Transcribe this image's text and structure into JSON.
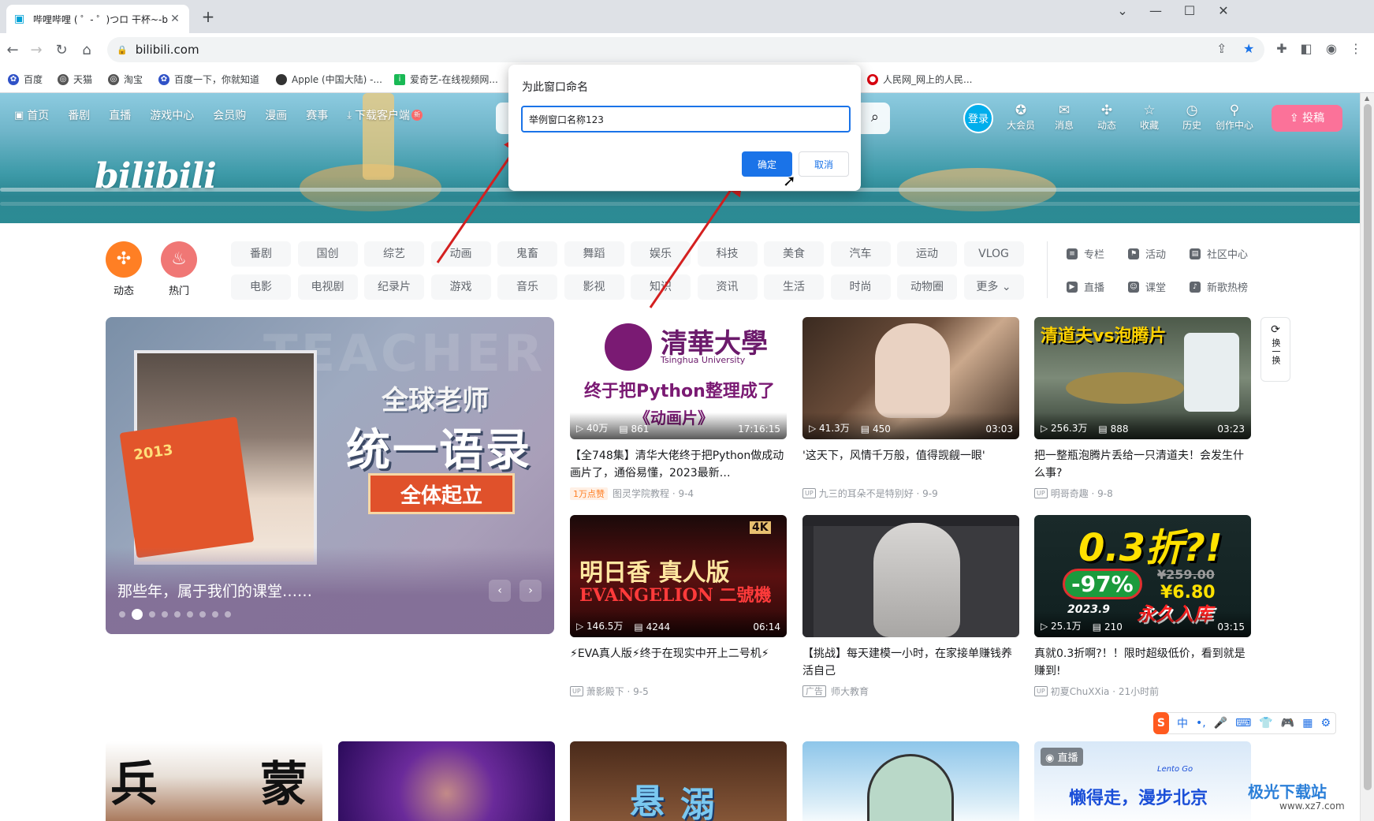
{
  "browser": {
    "tab_title": "哔哩哔哩 ( ゜- ゜)つロ 干杯~-bilibili",
    "new_tab": "+",
    "url": "bilibili.com",
    "window_controls": [
      "⌄",
      "—",
      "☐",
      "✕"
    ],
    "bookmarks": [
      "百度",
      "天猫",
      "淘宝",
      "百度一下，你就知道",
      "Apple (中国大陆) -...",
      "爱奇艺-在线视频网...",
      "人民网_网上的人民..."
    ],
    "bookmark_colors": [
      "#3052c7",
      "#555",
      "#555",
      "#3052c7",
      "#333",
      "#19b955",
      "#d7000f"
    ]
  },
  "header": {
    "nav": [
      "首页",
      "番剧",
      "直播",
      "游戏中心",
      "会员购",
      "漫画",
      "赛事",
      "下载客户端"
    ],
    "new_badge": "新",
    "logo": "bilibili",
    "login": "登录",
    "icons": [
      {
        "label": "大会员",
        "glyph": "✪"
      },
      {
        "label": "消息",
        "glyph": "✉"
      },
      {
        "label": "动态",
        "glyph": "✣"
      },
      {
        "label": "收藏",
        "glyph": "☆"
      },
      {
        "label": "历史",
        "glyph": "◷"
      },
      {
        "label": "创作中心",
        "glyph": "⚲"
      }
    ],
    "upload": "投稿",
    "upload_icon": "⇪"
  },
  "channels": {
    "big": [
      {
        "label": "动态",
        "glyph": "✣",
        "color": "#ff7f24"
      },
      {
        "label": "热门",
        "glyph": "♨",
        "color": "#f07775"
      }
    ],
    "row1": [
      "番剧",
      "国创",
      "综艺",
      "动画",
      "鬼畜",
      "舞蹈",
      "娱乐",
      "科技",
      "美食",
      "汽车",
      "运动",
      "VLOG"
    ],
    "row2": [
      "电影",
      "电视剧",
      "纪录片",
      "游戏",
      "音乐",
      "影视",
      "知识",
      "资讯",
      "生活",
      "时尚",
      "动物圈",
      "更多 ⌄"
    ],
    "side": [
      "专栏",
      "活动",
      "社区中心",
      "直播",
      "课堂",
      "新歌热榜"
    ]
  },
  "carousel": {
    "bg_text": "TEACHER",
    "book_text": "2013",
    "headline1": "全球老师",
    "headline2": "统一语录",
    "cta": "全体起立",
    "caption": "那些年，属于我们的课堂……",
    "prev": "‹",
    "next": "›",
    "dots": 9,
    "active_dot": 1
  },
  "refresh": {
    "icon": "⟳",
    "label": "换一换"
  },
  "videos": [
    {
      "overlay1": "清華大學",
      "overlay2": "Tsinghua University",
      "overlay3": "终于把Python整理成了",
      "overlay4": "《动画片》",
      "views": "40万",
      "danmaku": "861",
      "duration": "17:16:15",
      "title": "【全748集】清华大佬终于把Python做成动画片了，通俗易懂，2023最新…",
      "tag": "1万点赞",
      "author": "图灵学院教程",
      "date": "9-4",
      "ad": false
    },
    {
      "views": "41.3万",
      "danmaku": "450",
      "duration": "03:03",
      "title": "'这天下，风情千万般，值得觊觎一眼'",
      "tag": "",
      "author": "九三的耳朵不是特别好",
      "date": "9-9",
      "ad": false
    },
    {
      "overlay1": "清道夫vs泡腾片",
      "views": "256.3万",
      "danmaku": "888",
      "duration": "03:23",
      "title": "把一整瓶泡腾片丢给一只清道夫！会发生什么事?",
      "tag": "",
      "author": "明哥奇趣",
      "date": "9-8",
      "ad": false
    },
    {
      "overlay1": "明日香 真人版",
      "overlay2": "EVANGELION 二號機",
      "overlay3": "4K",
      "views": "146.5万",
      "danmaku": "4244",
      "duration": "06:14",
      "title": "⚡EVA真人版⚡终于在现实中开上二号机⚡",
      "tag": "",
      "author": "萧影殿下",
      "date": "9-5",
      "ad": false
    },
    {
      "views": "",
      "danmaku": "",
      "duration": "",
      "title": "【挑战】每天建模一小时，在家接单赚钱养活自己",
      "tag": "",
      "author": "师大教育",
      "date": "",
      "ad": true,
      "ad_label": "广告"
    },
    {
      "overlay1": "0.3折?!",
      "overlay2": "-97%",
      "overlay3": "¥259.00",
      "overlay4": "¥6.80",
      "overlay5": "2023.9",
      "overlay6": "永久入库",
      "views": "25.1万",
      "danmaku": "210",
      "duration": "03:15",
      "title": "真就0.3折啊?！！限时超级低价，看到就是赚到!",
      "tag": "",
      "author": "初夏ChuXXia",
      "date": "21小时前",
      "ad": false
    }
  ],
  "bottom_row": {
    "texts": [
      "兵",
      "蒙",
      "悬",
      "溺",
      "直播",
      "懒得走，漫步北京",
      "Lento Go"
    ]
  },
  "ime": {
    "items": [
      "中",
      "•,",
      "🎤",
      "⌨",
      "👕",
      "🎮",
      "▦",
      "⚙"
    ],
    "logo": "S"
  },
  "watermark": {
    "name": "极光下载站",
    "url": "www.xz7.com"
  },
  "dialog": {
    "title": "为此窗口命名",
    "input_value": "举例窗口名称123",
    "ok": "确定",
    "cancel": "取消"
  },
  "colors": {
    "accent": "#1a73e8",
    "bili_pink": "#fb7299",
    "bili_blue": "#00aeec",
    "annotation_arrow": "#d42020"
  }
}
